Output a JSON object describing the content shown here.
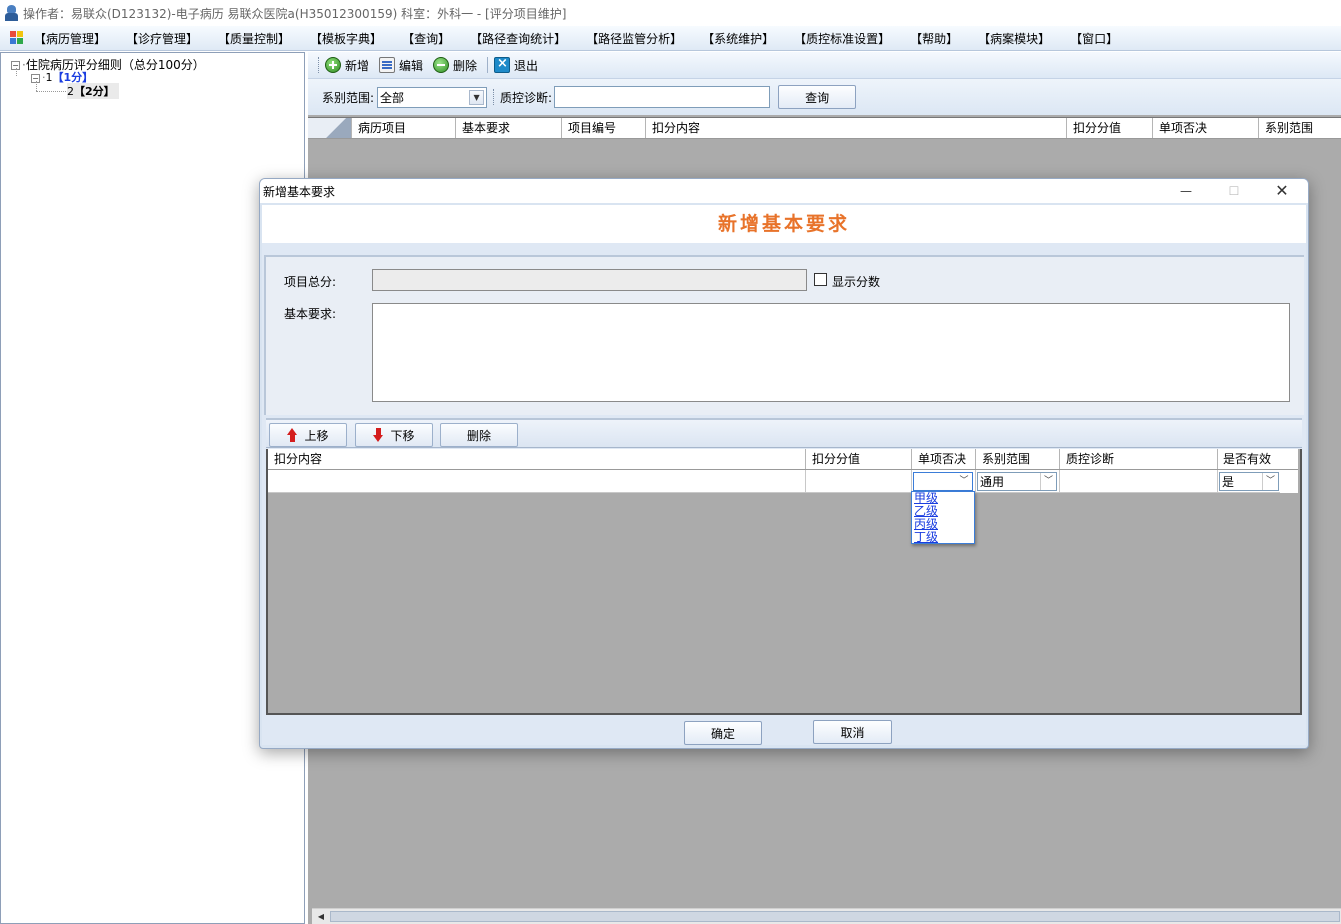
{
  "window": {
    "title": "操作者：易联众(D123132)-电子病历  易联众医院a(H35012300159)  科室：外科一 - [评分项目维护]"
  },
  "menu": {
    "items": [
      "【病历管理】",
      "【诊疗管理】",
      "【质量控制】",
      "【模板字典】",
      "【查询】",
      "【路径查询统计】",
      "【路径监管分析】",
      "【系统维护】",
      "【质控标准设置】",
      "【帮助】",
      "【病案模块】",
      "【窗口】"
    ]
  },
  "tree": {
    "root": "住院病历评分细则（总分100分）",
    "child1_num": "1",
    "child1_score": "【1分】",
    "child2_num": "2",
    "child2_score": "【2分】"
  },
  "toolbar": {
    "add": "新增",
    "edit": "编辑",
    "delete": "删除",
    "exit": "退出"
  },
  "filter": {
    "scope_label": "系别范围:",
    "scope_value": "全部",
    "diagnosis_label": "质控诊断:",
    "diagnosis_value": "",
    "query_button": "查询"
  },
  "main_grid": {
    "columns": [
      "病历项目",
      "基本要求",
      "项目编号",
      "扣分内容",
      "扣分分值",
      "单项否决",
      "系别范围"
    ]
  },
  "dialog": {
    "title": "新增基本要求",
    "heading": "新增基本要求",
    "total_score_label": "项目总分:",
    "total_score_value": "",
    "show_score_label": "显示分数",
    "show_score_checked": false,
    "requirement_label": "基本要求:",
    "requirement_value": "",
    "move_up": "上移",
    "move_down": "下移",
    "delete": "删除",
    "grid": {
      "columns": [
        "扣分内容",
        "扣分分值",
        "单项否决",
        "系别范围",
        "质控诊断",
        "是否有效"
      ],
      "row": {
        "deduct_content": "",
        "deduct_value": "",
        "veto": "",
        "scope": "通用",
        "diagnosis": "",
        "valid": "是"
      }
    },
    "veto_options": [
      "甲级",
      "乙级",
      "丙级",
      "丁级"
    ],
    "confirm": "确定",
    "cancel": "取消"
  }
}
